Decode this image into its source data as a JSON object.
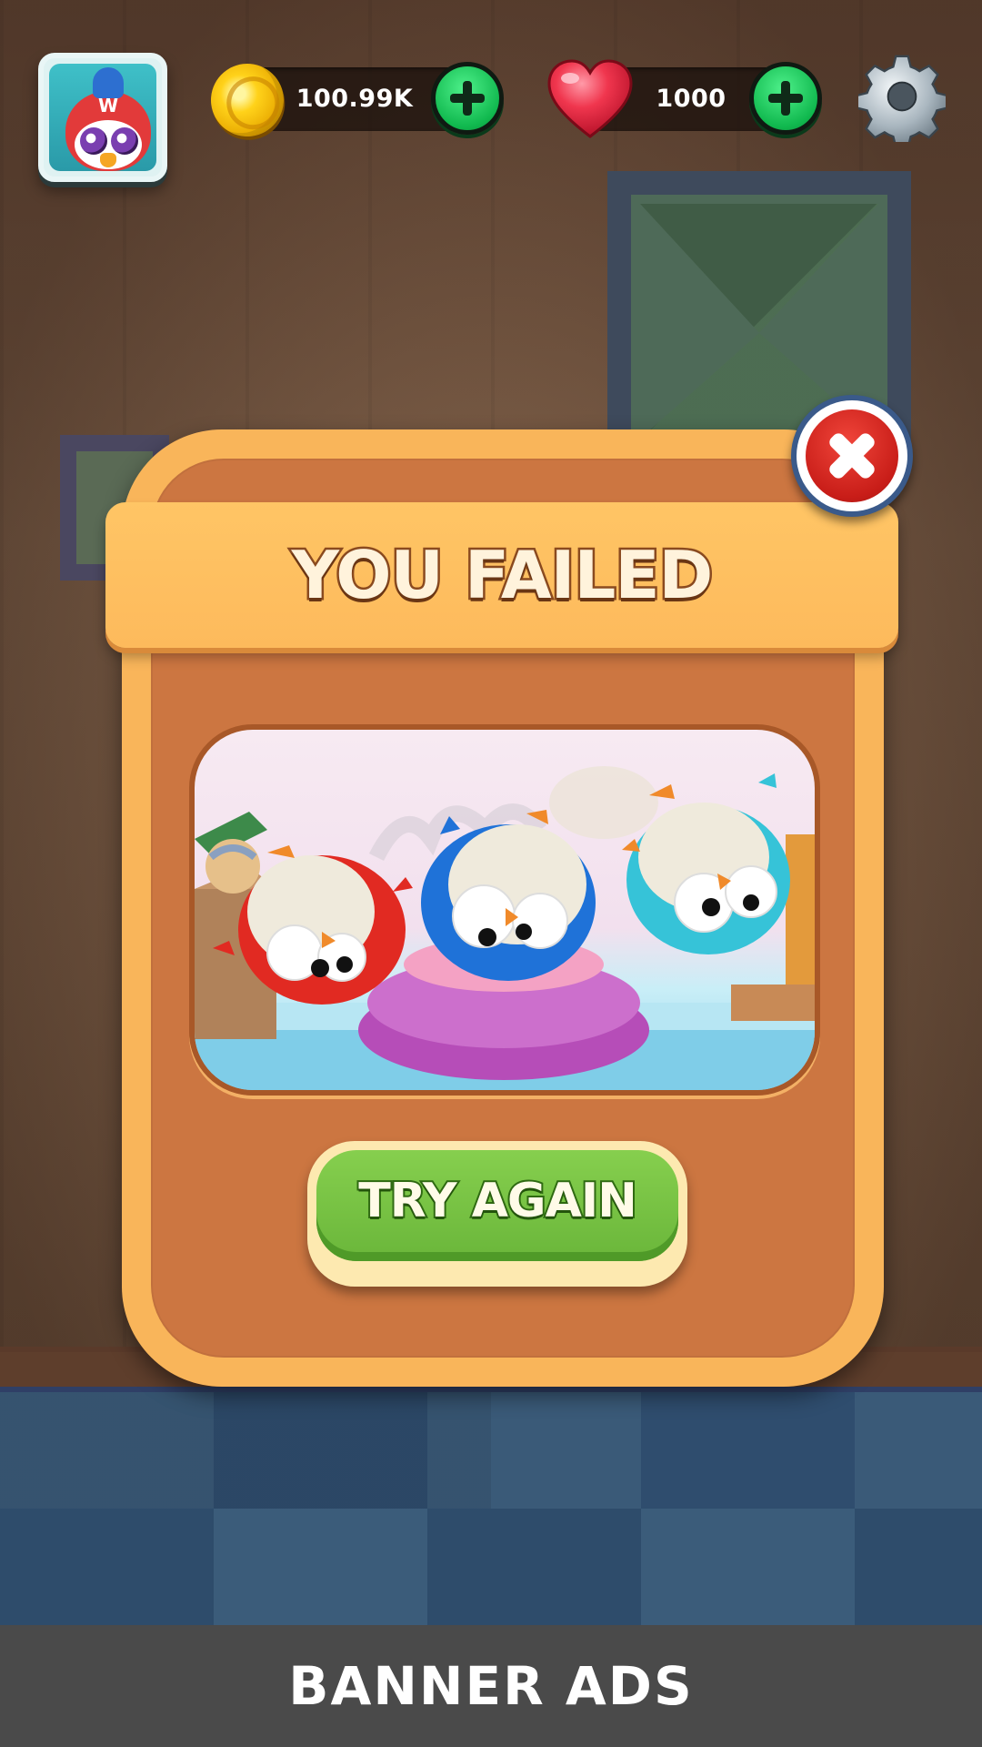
{
  "hud": {
    "coins": {
      "value": "100.99K",
      "icon": "coin-icon",
      "add_icon": "plus-icon"
    },
    "lives": {
      "value": "1000",
      "icon": "heart-icon",
      "add_icon": "plus-icon"
    },
    "settings_icon": "gear-icon",
    "avatar_icon": "bird-avatar-icon",
    "avatar_letter": "W"
  },
  "dialog": {
    "title": "YOU FAILED",
    "close_icon": "close-icon",
    "preview_icon": "three-plush-birds-scene",
    "try_again_label": "TRY AGAIN"
  },
  "banner": {
    "label": "BANNER ADS"
  },
  "colors": {
    "dialog_outer": "#f9b55a",
    "dialog_inner": "#cc7641",
    "try_again_green": "#6ab63a",
    "close_red": "#c81d18",
    "plus_green": "#10b84e",
    "banner_bg": "#4a4a4a"
  }
}
